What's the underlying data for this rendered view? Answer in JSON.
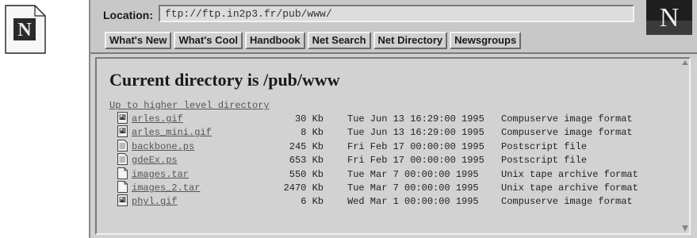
{
  "app_icon": {
    "name": "netscape-file-icon",
    "letter": "N"
  },
  "browser": {
    "logo": {
      "name": "netscape-logo-icon",
      "letter": "N"
    },
    "location": {
      "label": "Location:",
      "value": "ftp://ftp.in2p3.fr/pub/www/"
    },
    "directory_buttons": [
      {
        "label": "What's New"
      },
      {
        "label": "What's Cool"
      },
      {
        "label": "Handbook"
      },
      {
        "label": "Net Search"
      },
      {
        "label": "Net Directory"
      },
      {
        "label": "Newsgroups"
      }
    ],
    "page": {
      "title": "Current directory is /pub/www",
      "up_link": "Up to higher level directory",
      "files": [
        {
          "icon": "image-file-icon",
          "name": "arles.gif",
          "size": "30 Kb",
          "date": "Tue Jun 13 16:29:00 1995",
          "type": "Compuserve image format"
        },
        {
          "icon": "image-file-icon",
          "name": "arles_mini.gif",
          "size": "8 Kb",
          "date": "Tue Jun 13 16:29:00 1995",
          "type": "Compuserve image format"
        },
        {
          "icon": "text-file-icon",
          "name": "backbone.ps",
          "size": "245 Kb",
          "date": "Fri Feb 17 00:00:00 1995",
          "type": "Postscript file"
        },
        {
          "icon": "text-file-icon",
          "name": "gdeEx.ps",
          "size": "653 Kb",
          "date": "Fri Feb 17 00:00:00 1995",
          "type": "Postscript file"
        },
        {
          "icon": "blank-file-icon",
          "name": "images.tar",
          "size": "550 Kb",
          "date": "Tue Mar  7 00:00:00 1995",
          "type": "Unix tape archive format"
        },
        {
          "icon": "blank-file-icon",
          "name": "images_2.tar",
          "size": "2470 Kb",
          "date": "Tue Mar  7 00:00:00 1995",
          "type": "Unix tape archive format"
        },
        {
          "icon": "image-file-icon",
          "name": "phyl.gif",
          "size": "6 Kb",
          "date": "Wed Mar  1 00:00:00 1995",
          "type": "Compuserve image format"
        }
      ]
    }
  }
}
